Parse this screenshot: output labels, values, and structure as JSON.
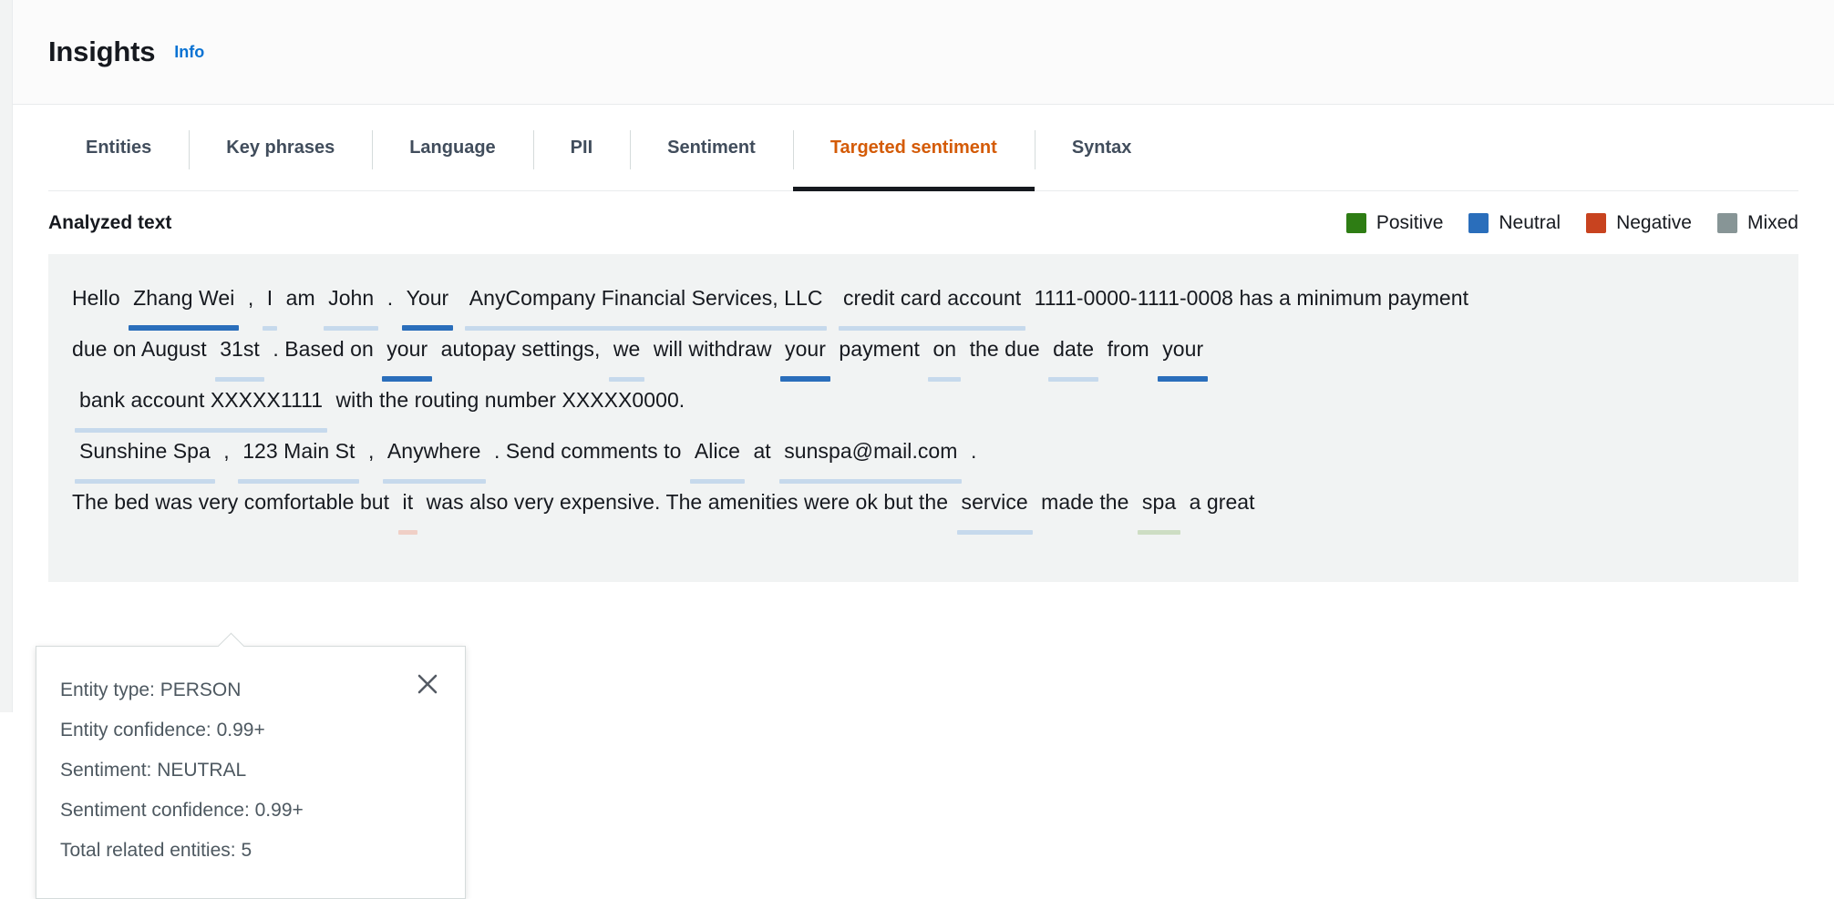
{
  "header": {
    "title": "Insights",
    "info_label": "Info"
  },
  "tabs": [
    {
      "label": "Entities",
      "active": false
    },
    {
      "label": "Key phrases",
      "active": false
    },
    {
      "label": "Language",
      "active": false
    },
    {
      "label": "PII",
      "active": false
    },
    {
      "label": "Sentiment",
      "active": false
    },
    {
      "label": "Targeted sentiment",
      "active": true
    },
    {
      "label": "Syntax",
      "active": false
    }
  ],
  "analysis": {
    "section_title": "Analyzed text",
    "legend": [
      {
        "label": "Positive",
        "color": "#2e7d14"
      },
      {
        "label": "Neutral",
        "color": "#2a6ebb"
      },
      {
        "label": "Negative",
        "color": "#c8431f"
      },
      {
        "label": "Mixed",
        "color": "#879596"
      }
    ],
    "lines": [
      {
        "id": "line-1",
        "tokens": [
          {
            "text": "Hello",
            "mark": "none"
          },
          {
            "text": "Zhang Wei",
            "mark": "neutral-strong"
          },
          {
            "text": ",",
            "mark": "none"
          },
          {
            "text": "I",
            "mark": "neutral-soft"
          },
          {
            "text": "am",
            "mark": "none"
          },
          {
            "text": "John",
            "mark": "neutral-soft"
          },
          {
            "text": ".",
            "mark": "none"
          },
          {
            "text": "Your",
            "mark": "neutral-strong"
          },
          {
            "text": "AnyCompany Financial Services, LLC",
            "mark": "neutral-soft"
          },
          {
            "text": "credit card account",
            "mark": "neutral-soft"
          },
          {
            "text": "1111-0000-1111-0008 has a minimum payment",
            "mark": "none"
          }
        ]
      },
      {
        "id": "line-2",
        "tokens": [
          {
            "text": "due on August",
            "mark": "none"
          },
          {
            "text": "31st",
            "mark": "neutral-soft"
          },
          {
            "text": ". Based on",
            "mark": "none"
          },
          {
            "text": "your",
            "mark": "neutral-strong"
          },
          {
            "text": "autopay settings,",
            "mark": "none"
          },
          {
            "text": "we",
            "mark": "neutral-soft"
          },
          {
            "text": "will withdraw",
            "mark": "none"
          },
          {
            "text": "your",
            "mark": "neutral-strong"
          },
          {
            "text": "payment",
            "mark": "none"
          },
          {
            "text": "on",
            "mark": "neutral-soft"
          },
          {
            "text": "the due",
            "mark": "none"
          },
          {
            "text": "date",
            "mark": "neutral-soft"
          },
          {
            "text": "from",
            "mark": "none"
          },
          {
            "text": "your",
            "mark": "neutral-strong"
          }
        ]
      },
      {
        "id": "line-3",
        "tokens": [
          {
            "text": "bank account XXXXX1111",
            "mark": "neutral-soft"
          },
          {
            "text": "with the routing number XXXXX0000.",
            "mark": "none"
          }
        ]
      },
      {
        "id": "line-4",
        "tokens": [
          {
            "text": "Sunshine Spa",
            "mark": "neutral-soft"
          },
          {
            "text": ",",
            "mark": "none"
          },
          {
            "text": "123 Main St",
            "mark": "neutral-soft"
          },
          {
            "text": ",",
            "mark": "none"
          },
          {
            "text": "Anywhere",
            "mark": "neutral-soft"
          },
          {
            "text": ". Send comments to",
            "mark": "none"
          },
          {
            "text": "Alice",
            "mark": "neutral-soft"
          },
          {
            "text": "at",
            "mark": "none"
          },
          {
            "text": "sunspa@mail.com",
            "mark": "neutral-soft"
          },
          {
            "text": ".",
            "mark": "none"
          }
        ]
      },
      {
        "id": "line-5",
        "tokens": [
          {
            "text": "The bed",
            "mark": "none"
          },
          {
            "text": "was very comfortable but",
            "mark": "none"
          },
          {
            "text": "it",
            "mark": "negative-soft"
          },
          {
            "text": "was also very expensive. The amenities were ok but the",
            "mark": "none"
          },
          {
            "text": "service",
            "mark": "neutral-soft"
          },
          {
            "text": "made the",
            "mark": "none"
          },
          {
            "text": "spa",
            "mark": "positive-soft"
          },
          {
            "text": "a great",
            "mark": "none"
          }
        ]
      }
    ]
  },
  "popover": {
    "entity_type": "Entity type: PERSON",
    "entity_confidence": "Entity confidence: 0.99+",
    "sentiment": "Sentiment: NEUTRAL",
    "sentiment_confidence": "Sentiment confidence: 0.99+",
    "total_related_entities": "Total related entities: 5",
    "close_icon": "close-icon"
  }
}
